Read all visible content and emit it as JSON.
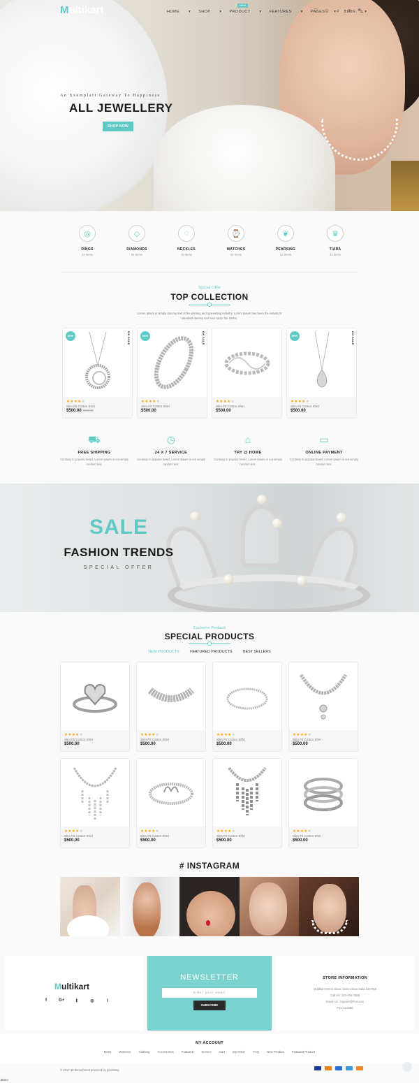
{
  "header": {
    "logo_initial": "M",
    "logo_rest": "ultikart",
    "menu": [
      "HOME",
      "SHOP",
      "PRODUCT",
      "FEATURES",
      "PAGES",
      "BLOG"
    ],
    "features_badge": "NEW"
  },
  "hero": {
    "subtitle": "An Exemplart Gateway To Happiness",
    "title": "ALL JEWELLERY",
    "button": "SHOP NOW"
  },
  "categories": [
    {
      "name": "RINGS",
      "count": "23 Items",
      "icon": "ring-icon"
    },
    {
      "name": "DIAMONDS",
      "count": "54 Items",
      "icon": "diamond-icon"
    },
    {
      "name": "NECKLES",
      "count": "15 Items",
      "icon": "necklace-icon"
    },
    {
      "name": "WATCHES",
      "count": "62 Items",
      "icon": "watch-icon"
    },
    {
      "name": "PEARSING",
      "count": "12 Items",
      "icon": "earring-icon"
    },
    {
      "name": "TIARA",
      "count": "33 Items",
      "icon": "tiara-icon"
    }
  ],
  "top_collection": {
    "subtitle": "Special Offer",
    "title": "TOP COLLECTION",
    "description": "Lorem Ipsum is simply dummy text of the printing and typesetting industry. Lorem Ipsum has been the industry's standard dummy text ever since the 1500s.",
    "products": [
      {
        "name": "Slim Fit Cotton Shirt",
        "price": "$500.00",
        "old_price": "$600.00",
        "rating": 4,
        "badge_new": "NEW",
        "badge_sale": "ON SALE",
        "image": "pendant-necklace"
      },
      {
        "name": "Slim Fit Cotton Shirt",
        "price": "$500.00",
        "old_price": "",
        "rating": 4,
        "badge_new": "NEW",
        "badge_sale": "ON SALE",
        "image": "tennis-bracelet"
      },
      {
        "name": "Slim Fit Cotton Shirt",
        "price": "$500.00",
        "old_price": "",
        "rating": 4,
        "badge_new": "",
        "badge_sale": "",
        "image": "infinity-bracelet"
      },
      {
        "name": "Slim Fit Cotton Shirt",
        "price": "$500.00",
        "old_price": "",
        "rating": 4,
        "badge_new": "NEW",
        "badge_sale": "ON SALE",
        "image": "drop-pendant"
      }
    ]
  },
  "services": [
    {
      "title": "FREE SHIPPING",
      "desc": "Contrary to popular belief, Lorem Ipsum is not simply random text.",
      "icon": "truck-icon"
    },
    {
      "title": "24 X 7 SERVICE",
      "desc": "Contrary to popular belief, Lorem Ipsum is not simply random text.",
      "icon": "clock-icon"
    },
    {
      "title": "TRY @ HOME",
      "desc": "Contrary to popular belief, Lorem Ipsum is not simply random text.",
      "icon": "home-icon"
    },
    {
      "title": "ONLINE PAYMENT",
      "desc": "Contrary to popular belief, Lorem Ipsum is not simply random text.",
      "icon": "card-icon"
    }
  ],
  "sale_banner": {
    "line1": "SALE",
    "line2": "FASHION TRENDS",
    "line3": "SPECIAL OFFER"
  },
  "special_products": {
    "subtitle": "Exclusive Products",
    "title": "SPECIAL PRODUCTS",
    "tabs": [
      "NEW PRODUCTS",
      "FEATURED PRODUCTS",
      "BEST SELLERS"
    ],
    "products": [
      {
        "name": "Slim Fit Cotton Shirt",
        "price": "$500.00",
        "rating": 4,
        "image": "heart-ring"
      },
      {
        "name": "Slim Fit Cotton Shirt",
        "price": "$500.00",
        "rating": 4,
        "image": "choker"
      },
      {
        "name": "Slim Fit Cotton Shirt",
        "price": "$500.00",
        "rating": 4,
        "image": "bangle"
      },
      {
        "name": "Slim Fit Cotton Shirt",
        "price": "$500.00",
        "rating": 4,
        "image": "v-necklace"
      },
      {
        "name": "Slim Fit Cotton Shirt",
        "price": "$500.00",
        "rating": 4,
        "image": "drop-necklace"
      },
      {
        "name": "Slim Fit Cotton Shirt",
        "price": "$500.00",
        "rating": 4,
        "image": "swan-bracelet"
      },
      {
        "name": "Slim Fit Cotton Shirt",
        "price": "$500.00",
        "rating": 4,
        "image": "bib-necklace"
      },
      {
        "name": "Slim Fit Cotton Shirt",
        "price": "$500.00",
        "rating": 4,
        "image": "wrap-ring"
      }
    ]
  },
  "instagram": {
    "title": "# INSTAGRAM"
  },
  "footer": {
    "logo_initial": "M",
    "logo_rest": "ultikart",
    "social": [
      "f",
      "G+",
      "t",
      "ig",
      "rss"
    ],
    "newsletter_title": "NEWSLETTER",
    "newsletter_placeholder": "Enter your email",
    "subscribe": "SUBSCRIBE",
    "store_title": "STORE INFORMATION",
    "store_lines": [
      "Multikart Demo Store, Demo store India 345-659",
      "Call Us: 123-456-7898",
      "Email Us: Support@Fiot.com",
      "Fax: 123456"
    ],
    "account_title": "MY ACCOUNT",
    "account_links": [
      "Mens",
      "Womens",
      "Clothing",
      "Accessories",
      "Featured",
      "Service",
      "Cart",
      "My Order",
      "FAQ",
      "New Product",
      "Featured Product"
    ],
    "copyright": "© 2017-18 themeforest powered by pixelstrap",
    "payments": [
      "visa",
      "mastercard",
      "paypal",
      "amex",
      "discover"
    ],
    "demo_label": "demo"
  },
  "colors": {
    "accent": "#5fcac5",
    "star": "#ffa200"
  }
}
